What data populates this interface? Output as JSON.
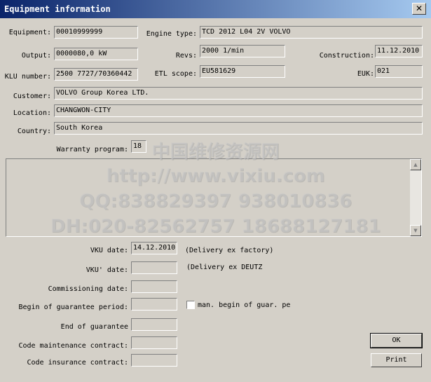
{
  "window": {
    "title": "Equipment information",
    "close_glyph": "✕"
  },
  "labels": {
    "equipment": "Equipment:",
    "engine_type": "Engine type:",
    "output": "Output:",
    "revs": "Revs:",
    "construction": "Construction:",
    "klu_number": "KLU number:",
    "etl_scope": "ETL scope:",
    "euk": "EUK:",
    "customer": "Customer:",
    "location": "Location:",
    "country": "Country:",
    "warranty_program": "Warranty program:",
    "vku_date": "VKU date:",
    "vku2_date": "VKU' date:",
    "commissioning_date": "Commissioning date:",
    "begin_guarantee": "Begin of guarantee period:",
    "end_guarantee": "End of guarantee",
    "code_maintenance": "Code maintenance contract:",
    "code_insurance": "Code insurance contract:"
  },
  "values": {
    "equipment": "00010999999",
    "engine_type": "TCD 2012 L04 2V VOLVO",
    "output": "0000080,0 kW",
    "revs": "2000 1/min",
    "construction": "11.12.2010",
    "klu_number": "2500 7727/70360442",
    "etl_scope": "EU581629",
    "euk": "021",
    "customer": "VOLVO Group Korea LTD.",
    "location": "CHANGWON-CITY",
    "country": "South Korea",
    "warranty_program": "18",
    "vku_date": "14.12.2010",
    "vku2_date": "",
    "commissioning_date": "",
    "begin_guarantee": "",
    "end_guarantee": "",
    "code_maintenance": "",
    "code_insurance": ""
  },
  "notes": {
    "delivery_factory": "(Delivery ex factory)",
    "delivery_deutz": "(Delivery ex DEUTZ",
    "man_begin": "man. begin of guar. pe"
  },
  "checkbox": {
    "man_begin_checked": false
  },
  "buttons": {
    "ok": "OK",
    "print": "Print"
  },
  "watermark": {
    "line1": "中国维修资源网",
    "line2": "http://www.vixiu.com",
    "line3": "QQ:838829397 938010836",
    "line4": "DH:020-82562757 18688127181"
  },
  "icons": {
    "close": "close-icon",
    "scroll_up": "arrow-up-icon",
    "scroll_down": "arrow-down-icon"
  },
  "colors": {
    "face": "#d4d0c8",
    "title_start": "#0a246a",
    "title_end": "#a6caf0"
  }
}
